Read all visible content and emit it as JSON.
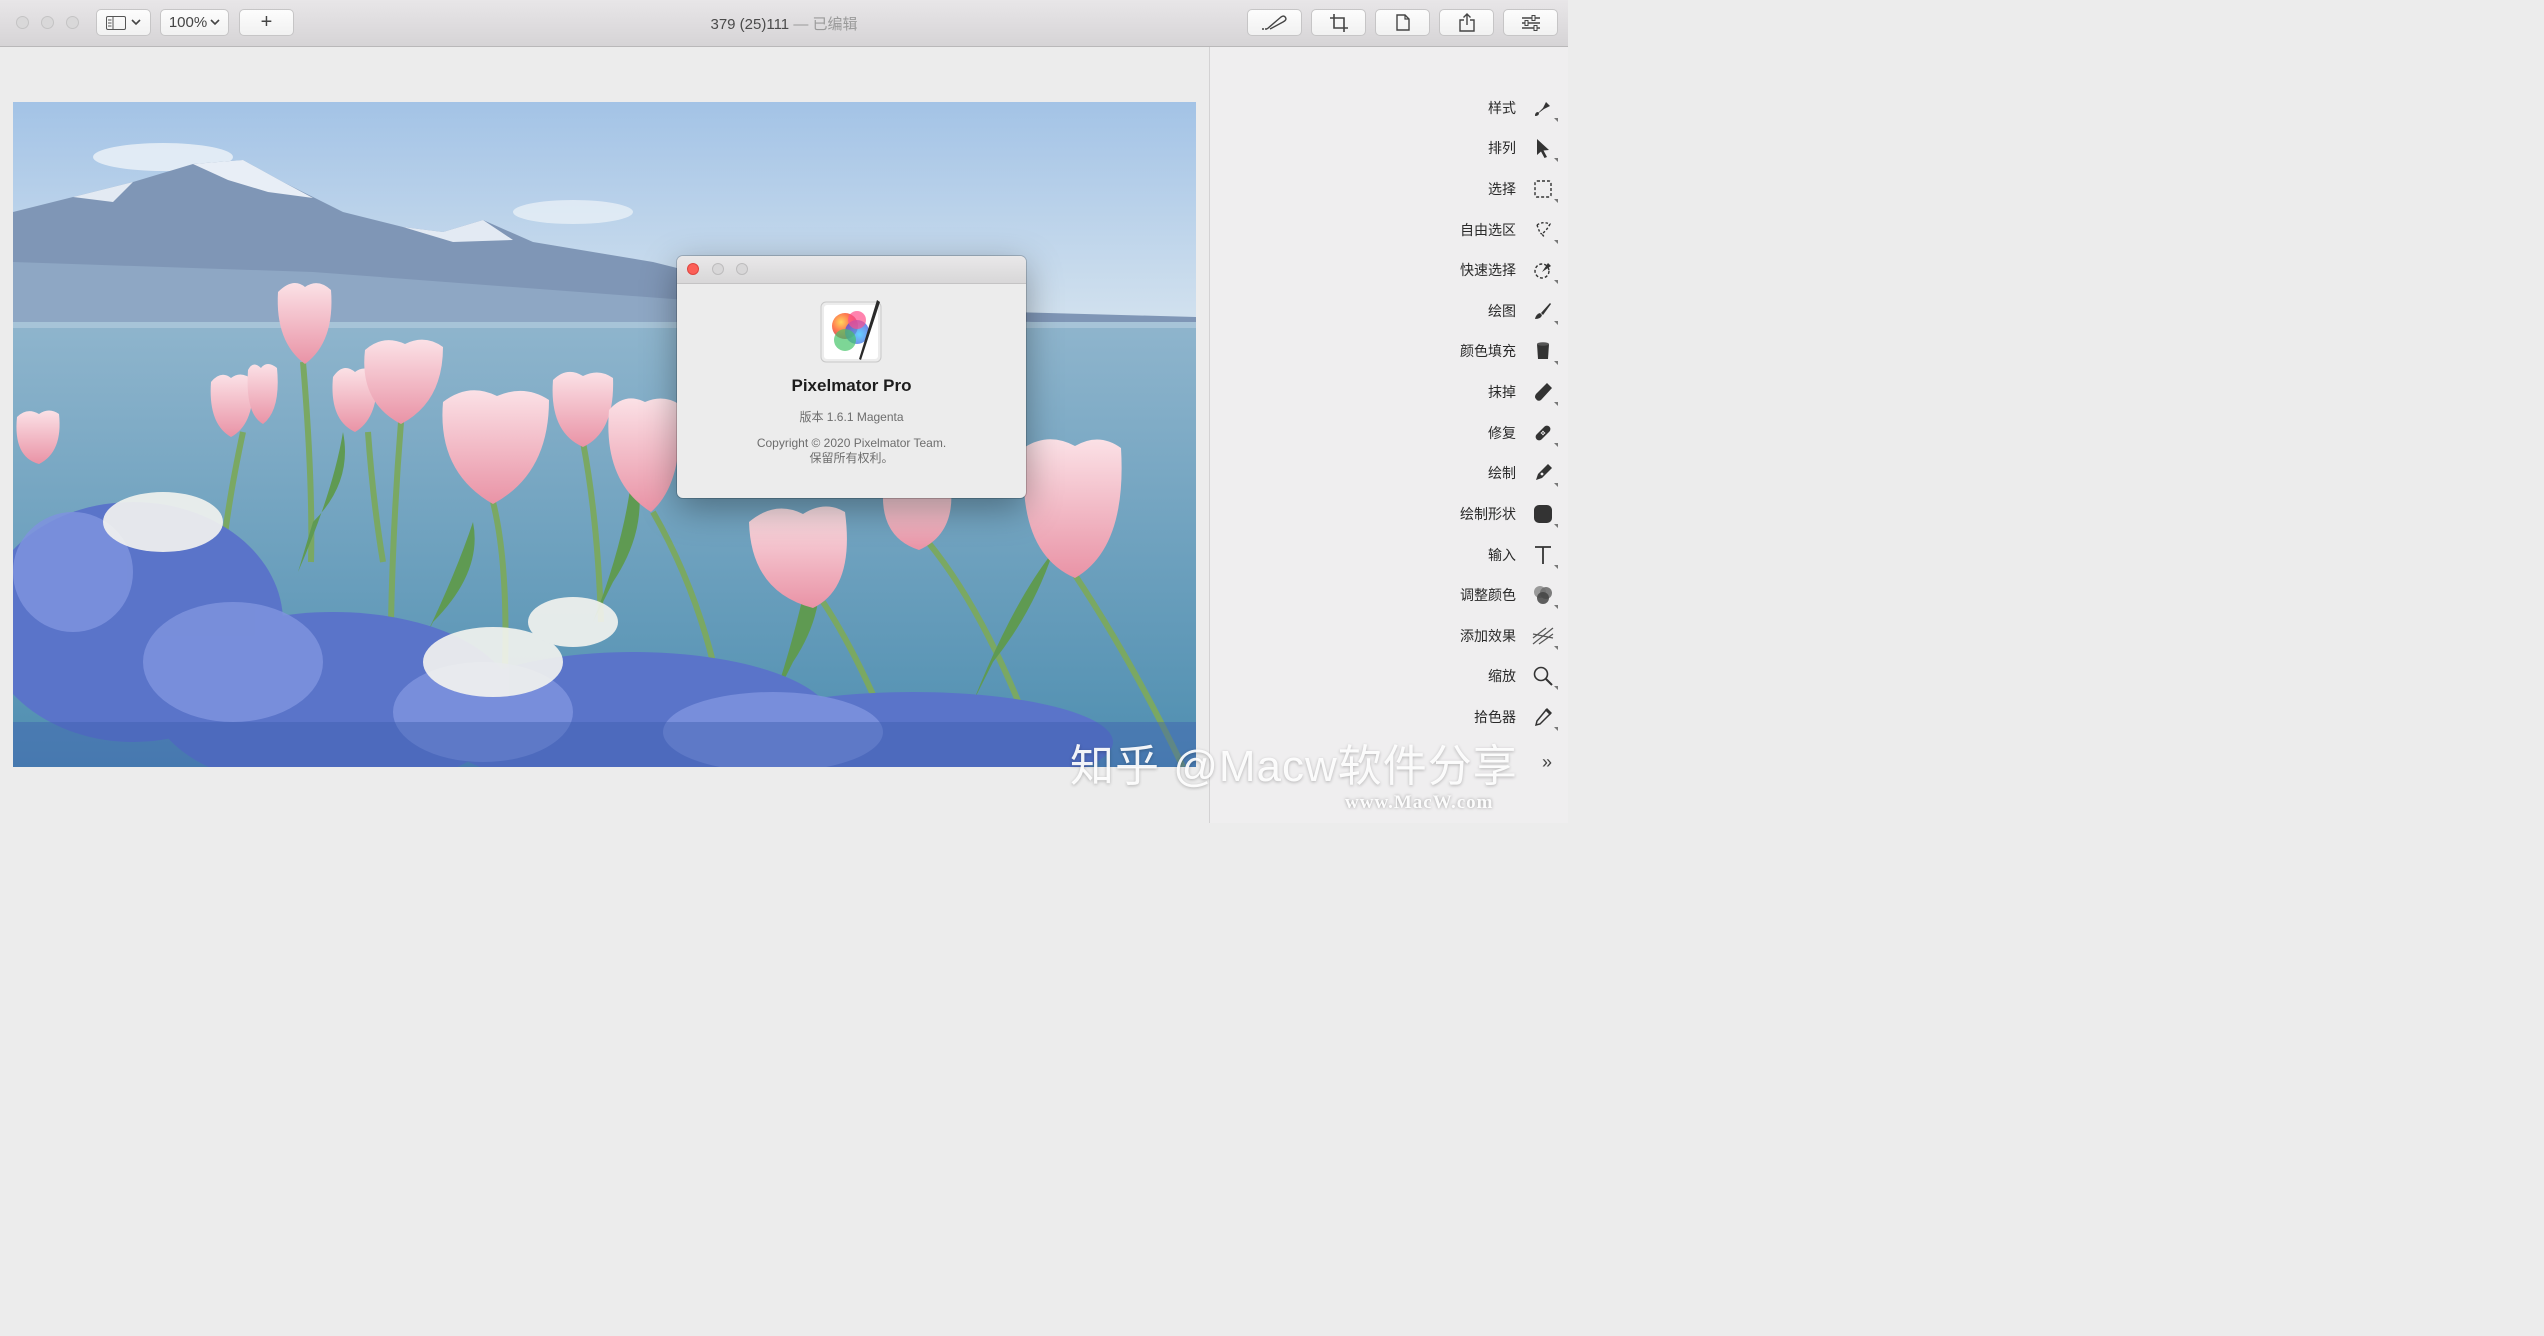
{
  "window": {
    "title": "379 (25)111",
    "title_separator": " — ",
    "title_status": "已编辑"
  },
  "toolbar": {
    "zoom_value": "100%",
    "add_label": "+",
    "right_buttons": [
      "annotate-icon",
      "crop-icon",
      "document-icon",
      "share-icon",
      "sliders-icon"
    ]
  },
  "sidebar": {
    "tools": [
      {
        "label": "样式",
        "icon": "style-brush-icon"
      },
      {
        "label": "排列",
        "icon": "arrow-pointer-icon"
      },
      {
        "label": "选择",
        "icon": "rect-select-icon"
      },
      {
        "label": "自由选区",
        "icon": "lasso-icon"
      },
      {
        "label": "快速选择",
        "icon": "quick-select-icon"
      },
      {
        "label": "绘图",
        "icon": "paint-brush-icon"
      },
      {
        "label": "颜色填充",
        "icon": "paint-bucket-icon"
      },
      {
        "label": "抹掉",
        "icon": "eraser-icon"
      },
      {
        "label": "修复",
        "icon": "bandage-icon"
      },
      {
        "label": "绘制",
        "icon": "pen-nib-icon"
      },
      {
        "label": "绘制形状",
        "icon": "rounded-square-icon"
      },
      {
        "label": "输入",
        "icon": "text-t-icon"
      },
      {
        "label": "调整颜色",
        "icon": "color-circles-icon"
      },
      {
        "label": "添加效果",
        "icon": "effects-icon"
      },
      {
        "label": "缩放",
        "icon": "magnifier-icon"
      },
      {
        "label": "拾色器",
        "icon": "eyedropper-icon"
      }
    ],
    "more": "»"
  },
  "about_dialog": {
    "app_name": "Pixelmator Pro",
    "version": "版本 1.6.1 Magenta",
    "copyright_line1": "Copyright © 2020 Pixelmator Team.",
    "copyright_line2": "保留所有权利。"
  },
  "watermark": {
    "text": "知乎 @Macw软件分享",
    "url": "www.MacW.com"
  },
  "colors": {
    "close_red": "#fc5f57",
    "titlebar": "#dedcde",
    "sidebar_bg": "#efeeef"
  }
}
